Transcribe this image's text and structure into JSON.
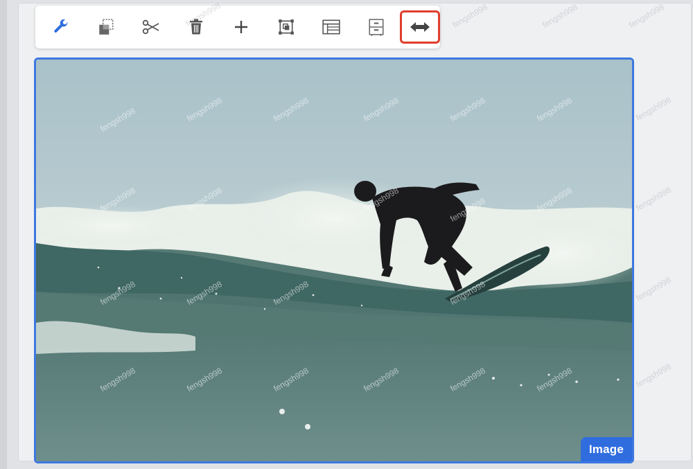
{
  "toolbar": {
    "tools": [
      {
        "icon": "wrench-icon",
        "selected": false
      },
      {
        "icon": "crop-icon",
        "selected": false
      },
      {
        "icon": "scissors-icon",
        "selected": false
      },
      {
        "icon": "trash-icon",
        "selected": false
      },
      {
        "icon": "plus-icon",
        "selected": false
      },
      {
        "icon": "select-object-icon",
        "selected": false
      },
      {
        "icon": "table-icon",
        "selected": false
      },
      {
        "icon": "cabinet-icon",
        "selected": false
      },
      {
        "icon": "resize-horizontal-icon",
        "selected": true
      }
    ],
    "selected_outline_color": "#e03d2b",
    "icon_color_active": "#2f6ddf",
    "icon_color_default": "#555555"
  },
  "image_block": {
    "badge_label": "Image",
    "border_color": "#3d78e0",
    "badge_color": "#2f6ddf"
  },
  "watermark": {
    "text": "fengsh998"
  }
}
